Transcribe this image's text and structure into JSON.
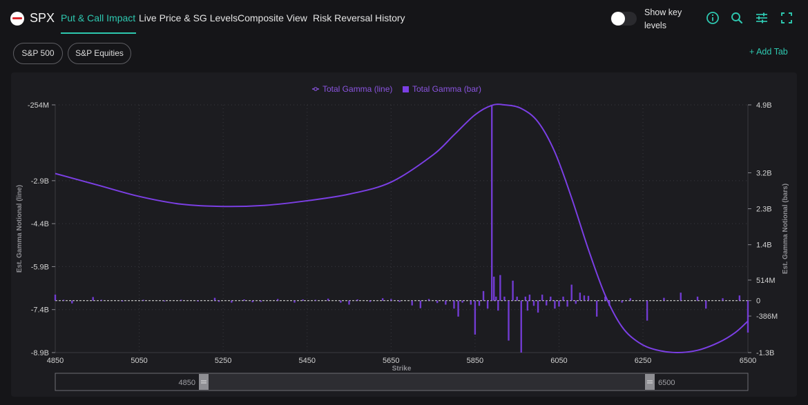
{
  "header": {
    "ticker": "SPX",
    "tabs": [
      {
        "label": "Put & Call Impact",
        "active": true
      },
      {
        "label": "Live Price & SG Levels",
        "active": false
      },
      {
        "label": "Composite View",
        "active": false
      },
      {
        "label": "Risk Reversal",
        "active": false
      },
      {
        "label": "History",
        "active": false
      }
    ],
    "toggle_label": "Show key levels",
    "toggle_on": false,
    "icons": [
      "info-icon",
      "search-icon",
      "sliders-icon",
      "fullscreen-icon"
    ]
  },
  "chips": [
    "S&P 500",
    "S&P Equities"
  ],
  "add_tab_label": "+ Add Tab",
  "colors": {
    "accent": "#2ec8b0",
    "series": "#7b3fe4",
    "background": "#151518",
    "panel": "#1c1c20"
  },
  "chart_data": {
    "type": "line",
    "xlabel": "Strike",
    "ylabel_left": "Est. Gamma Notional (line)",
    "ylabel_right": "Est. Gamma Notional (bars)",
    "legend": [
      "Total Gamma (line)",
      "Total Gamma (bar)"
    ],
    "legend_position": "top-center",
    "xlim": [
      4850,
      6500
    ],
    "x_ticks": [
      "4850",
      "5050",
      "5250",
      "5450",
      "5650",
      "5850",
      "6050",
      "6250",
      "6500"
    ],
    "y_left_ticks": [
      "-254M",
      "-2.9B",
      "-4.4B",
      "-5.9B",
      "-7.4B",
      "-8.9B"
    ],
    "y_right_ticks": [
      "4.9B",
      "3.2B",
      "2.3B",
      "1.4B",
      "514M",
      "0",
      "-386M",
      "-1.3B"
    ],
    "y_left_lim": [
      -8.9,
      -0.254
    ],
    "y_right_lim": [
      -1.3,
      4.9
    ],
    "units": "billions",
    "grid": true,
    "series": [
      {
        "name": "Total Gamma (line)",
        "x": [
          4850,
          4950,
          5050,
          5150,
          5250,
          5350,
          5450,
          5550,
          5650,
          5750,
          5800,
          5850,
          5890,
          5920,
          5960,
          6000,
          6040,
          6080,
          6120,
          6160,
          6200,
          6240,
          6280,
          6330,
          6380,
          6430,
          6470,
          6500
        ],
        "values": [
          -2.65,
          -3.05,
          -3.45,
          -3.72,
          -3.8,
          -3.76,
          -3.6,
          -3.37,
          -2.95,
          -2.0,
          -1.3,
          -0.6,
          -0.27,
          -0.254,
          -0.38,
          -0.85,
          -1.9,
          -3.5,
          -5.3,
          -6.9,
          -8.0,
          -8.55,
          -8.8,
          -8.9,
          -8.82,
          -8.55,
          -8.2,
          -7.8
        ]
      },
      {
        "name": "Total Gamma (bar)",
        "x": [
          4850,
          4870,
          4890,
          4940,
          4960,
          5010,
          5060,
          5110,
          5150,
          5190,
          5230,
          5240,
          5270,
          5300,
          5320,
          5340,
          5380,
          5420,
          5440,
          5470,
          5500,
          5530,
          5550,
          5570,
          5600,
          5630,
          5650,
          5670,
          5700,
          5720,
          5740,
          5760,
          5780,
          5800,
          5810,
          5820,
          5840,
          5850,
          5860,
          5870,
          5880,
          5890,
          5895,
          5900,
          5905,
          5910,
          5920,
          5930,
          5940,
          5950,
          5960,
          5970,
          5975,
          5980,
          5990,
          6000,
          6010,
          6020,
          6030,
          6040,
          6050,
          6060,
          6070,
          6080,
          6090,
          6100,
          6110,
          6120,
          6140,
          6160,
          6170,
          6200,
          6220,
          6260,
          6300,
          6340,
          6380,
          6400,
          6440,
          6480,
          6500
        ],
        "values": [
          0.15,
          0.02,
          -0.07,
          0.09,
          0.02,
          -0.02,
          0.02,
          -0.02,
          0.02,
          -0.02,
          0.07,
          -0.03,
          -0.05,
          0.03,
          -0.04,
          -0.03,
          0.04,
          -0.05,
          0.03,
          0.02,
          0.05,
          -0.05,
          -0.1,
          0.03,
          -0.03,
          0.06,
          0.04,
          -0.03,
          -0.12,
          -0.19,
          0.04,
          -0.06,
          -0.1,
          -0.2,
          -0.4,
          -0.05,
          -0.1,
          -0.85,
          -0.13,
          0.24,
          -0.2,
          4.9,
          0.6,
          0.1,
          -0.25,
          0.64,
          0.1,
          -1.0,
          0.5,
          0.1,
          -1.3,
          0.1,
          -0.25,
          0.15,
          -0.13,
          -0.3,
          0.15,
          -0.12,
          0.1,
          -0.2,
          -0.15,
          0.1,
          -0.15,
          0.4,
          -0.08,
          0.2,
          0.13,
          0.12,
          -0.4,
          0.1,
          -0.13,
          -0.05,
          0.06,
          -0.5,
          0.07,
          0.2,
          0.1,
          -0.2,
          0.06,
          0.13,
          -0.8
        ]
      }
    ]
  },
  "range_slider": {
    "start_label": "4850",
    "end_label": "6500"
  }
}
